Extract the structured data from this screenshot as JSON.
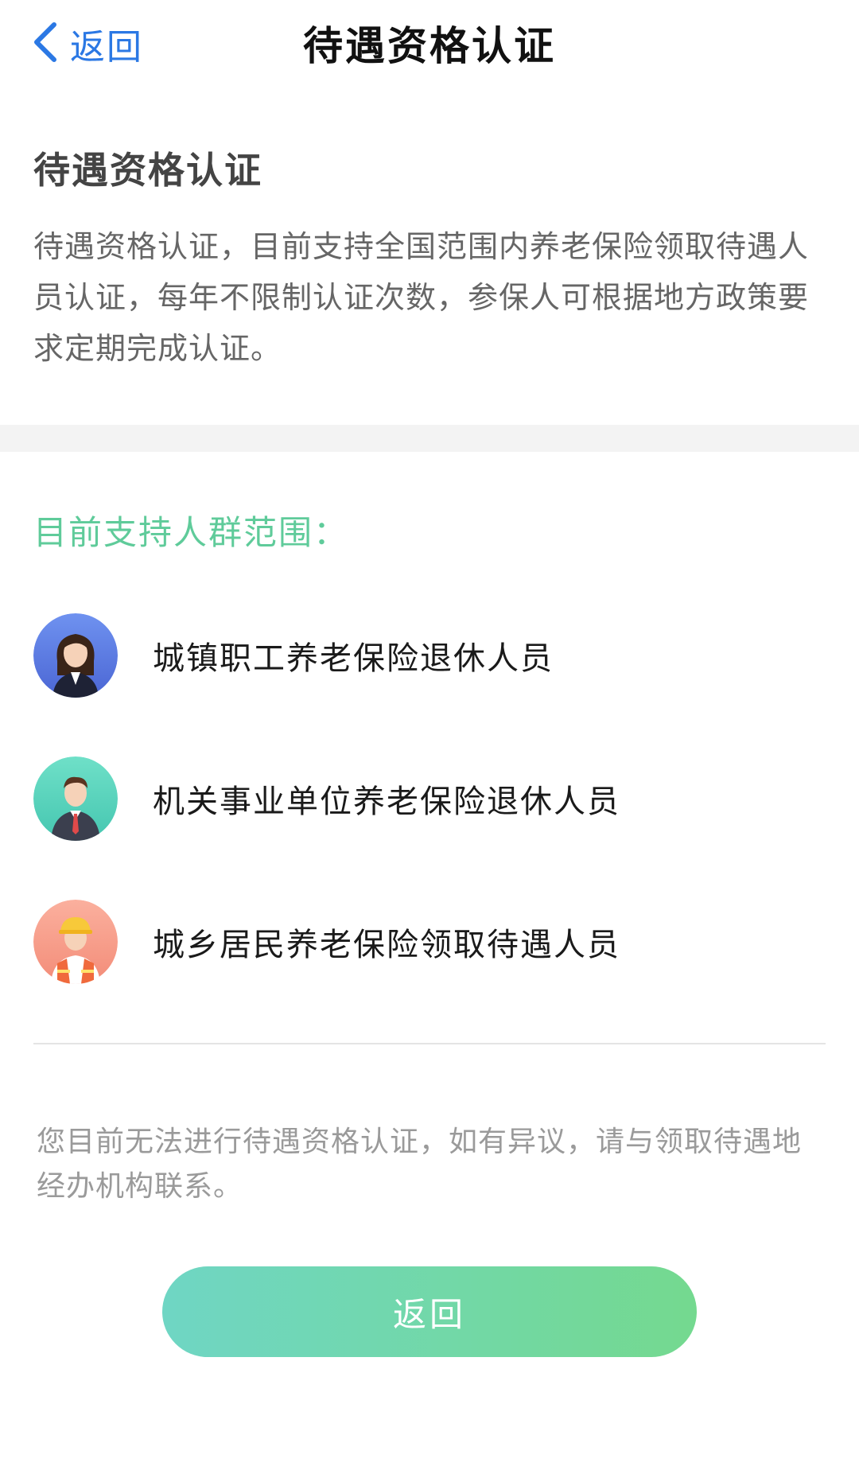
{
  "header": {
    "back_label": "返回",
    "title": "待遇资格认证"
  },
  "intro": {
    "heading": "待遇资格认证",
    "description": "待遇资格认证，目前支持全国范围内养老保险领取待遇人员认证，每年不限制认证次数，参保人可根据地方政策要求定期完成认证。"
  },
  "groups": {
    "title": "目前支持人群范围：",
    "items": [
      {
        "label": "城镇职工养老保险退休人员",
        "icon": "female-employee-avatar-icon",
        "color": "#5b7fe3"
      },
      {
        "label": "机关事业单位养老保险退休人员",
        "icon": "male-official-avatar-icon",
        "color": "#5fd6be"
      },
      {
        "label": "城乡居民养老保险领取待遇人员",
        "icon": "worker-avatar-icon",
        "color": "#f79a86"
      }
    ]
  },
  "notice": "您目前无法进行待遇资格认证，如有异议，请与领取待遇地经办机构联系。",
  "footer": {
    "return_label": "返回"
  },
  "colors": {
    "accent_blue": "#2b78e4",
    "accent_green": "#5fcb9a",
    "button_gradient_start": "#6fd6c4",
    "button_gradient_end": "#74d98f"
  }
}
